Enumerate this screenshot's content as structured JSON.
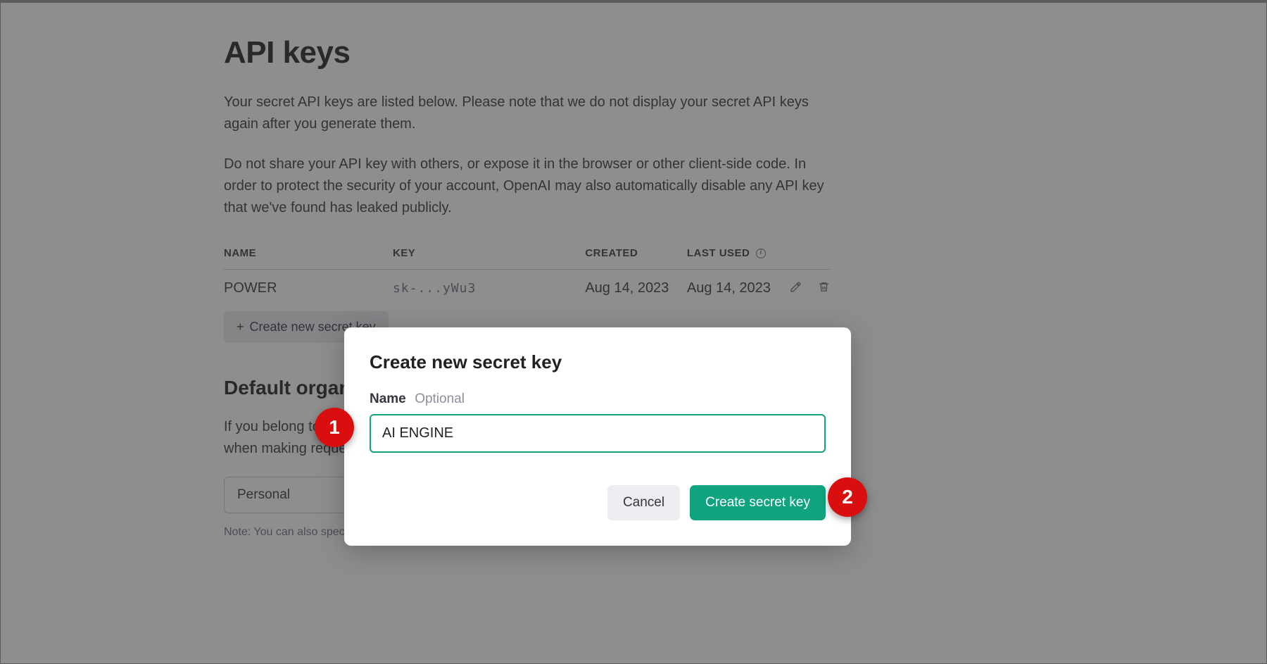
{
  "page": {
    "title": "API keys",
    "desc1": "Your secret API keys are listed below. Please note that we do not display your secret API keys again after you generate them.",
    "desc2": "Do not share your API key with others, or expose it in the browser or other client-side code. In order to protect the security of your account, OpenAI may also automatically disable any API key that we've found has leaked publicly."
  },
  "table": {
    "headers": {
      "name": "NAME",
      "key": "KEY",
      "created": "CREATED",
      "last_used": "LAST USED"
    },
    "rows": [
      {
        "name": "POWER",
        "key": "sk-...yWu3",
        "created": "Aug 14, 2023",
        "last_used": "Aug 14, 2023"
      }
    ]
  },
  "buttons": {
    "create_new_key": "Create new secret key"
  },
  "org_section": {
    "title": "Default organization",
    "desc": "If you belong to multiple organizations, this setting controls which organization is used by default when making requests with the API keys above.",
    "select_value": "Personal",
    "note": "Note: You can also specify which organization to use for each API request. See Authentication to learn more."
  },
  "modal": {
    "title": "Create new secret key",
    "name_label": "Name",
    "optional": "Optional",
    "name_value": "AI ENGINE",
    "cancel": "Cancel",
    "submit": "Create secret key"
  },
  "annotations": {
    "b1": "1",
    "b2": "2"
  }
}
